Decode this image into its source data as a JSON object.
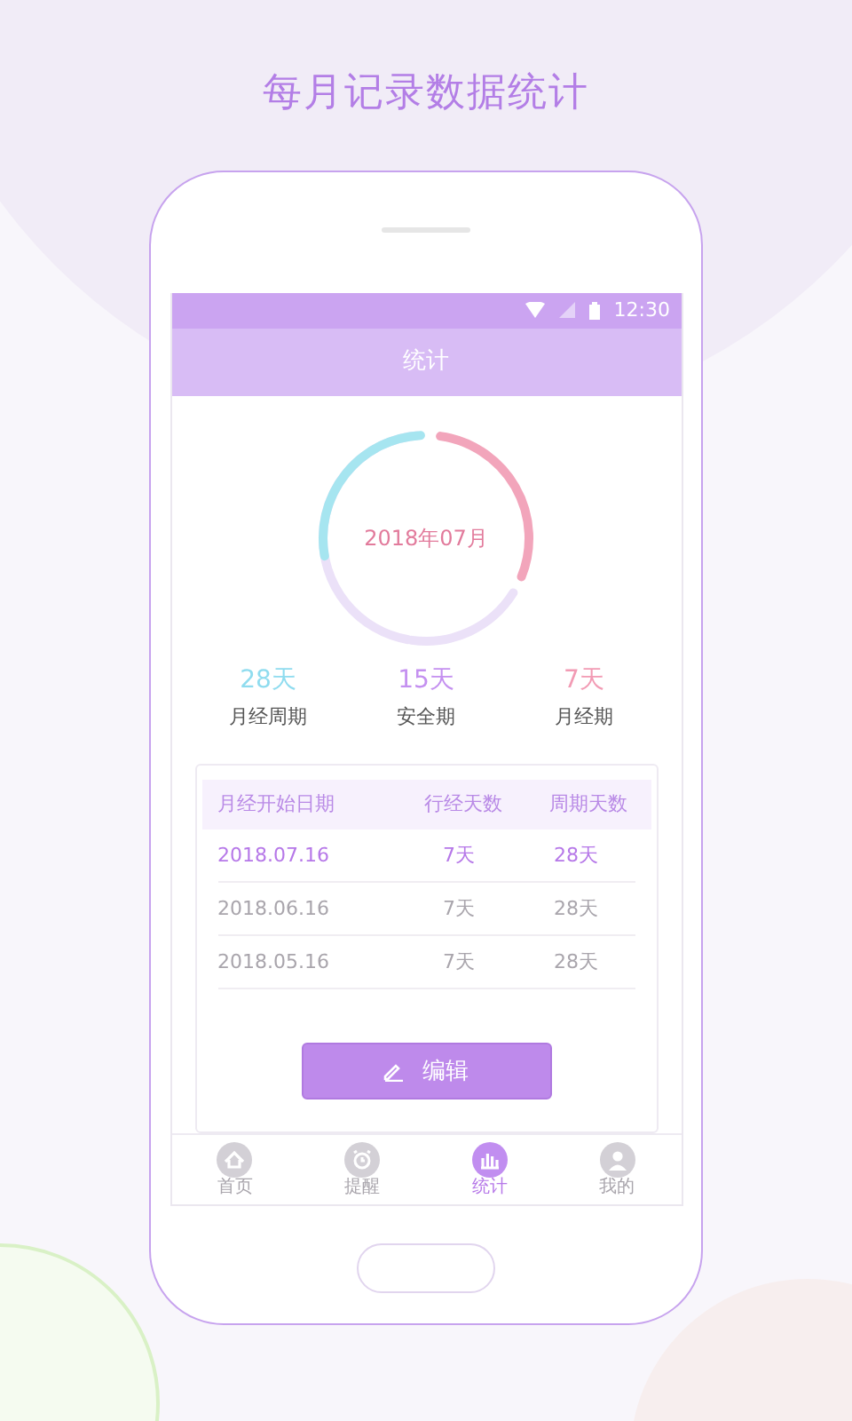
{
  "headline": "每月记录数据统计",
  "status_bar": {
    "time": "12:30"
  },
  "app_bar": {
    "title": "统计"
  },
  "ring": {
    "center_label": "2018年07月"
  },
  "summary": [
    {
      "value": "28天",
      "label": "月经周期",
      "color": "#8fdcef"
    },
    {
      "value": "15天",
      "label": "安全期",
      "color": "#c490f0"
    },
    {
      "value": "7天",
      "label": "月经期",
      "color": "#f29bb4"
    }
  ],
  "table": {
    "columns": [
      "月经开始日期",
      "行经天数",
      "周期天数"
    ],
    "rows": [
      {
        "cells": [
          "2018.07.16",
          "7天",
          "28天"
        ],
        "selected": true
      },
      {
        "cells": [
          "2018.06.16",
          "7天",
          "28天"
        ],
        "selected": false
      },
      {
        "cells": [
          "2018.05.16",
          "7天",
          "28天"
        ],
        "selected": false
      }
    ]
  },
  "edit_button": {
    "label": "编辑"
  },
  "tabs": [
    {
      "label": "首页",
      "kind": "home",
      "selected": false
    },
    {
      "label": "提醒",
      "kind": "alarm",
      "selected": false
    },
    {
      "label": "统计",
      "kind": "stats",
      "selected": true
    },
    {
      "label": "我的",
      "kind": "profile",
      "selected": false
    }
  ]
}
